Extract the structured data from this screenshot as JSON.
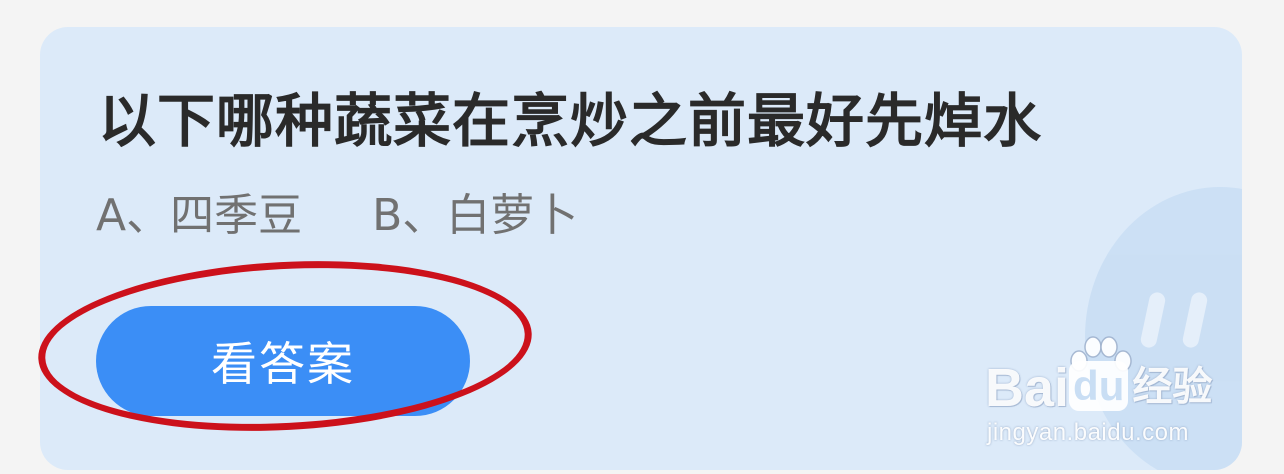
{
  "question": {
    "text": "以下哪种蔬菜在烹炒之前最好先焯水"
  },
  "options": [
    {
      "label": "A、四季豆"
    },
    {
      "label": "B、白萝卜"
    }
  ],
  "answer_button": {
    "label": "看答案",
    "color": "#3b8ef6"
  },
  "highlight": {
    "color": "#cc111b"
  },
  "watermark": {
    "brand_bai": "Bai",
    "brand_du": "du",
    "brand_jingyan": "经验",
    "url": "jingyan.baidu.com",
    "icon": "baidu-paw-icon"
  },
  "colors": {
    "card_background": "#dceaf9",
    "page_background": "#f4f4f4",
    "question_text": "#2a2a2a",
    "option_text": "#717171"
  }
}
